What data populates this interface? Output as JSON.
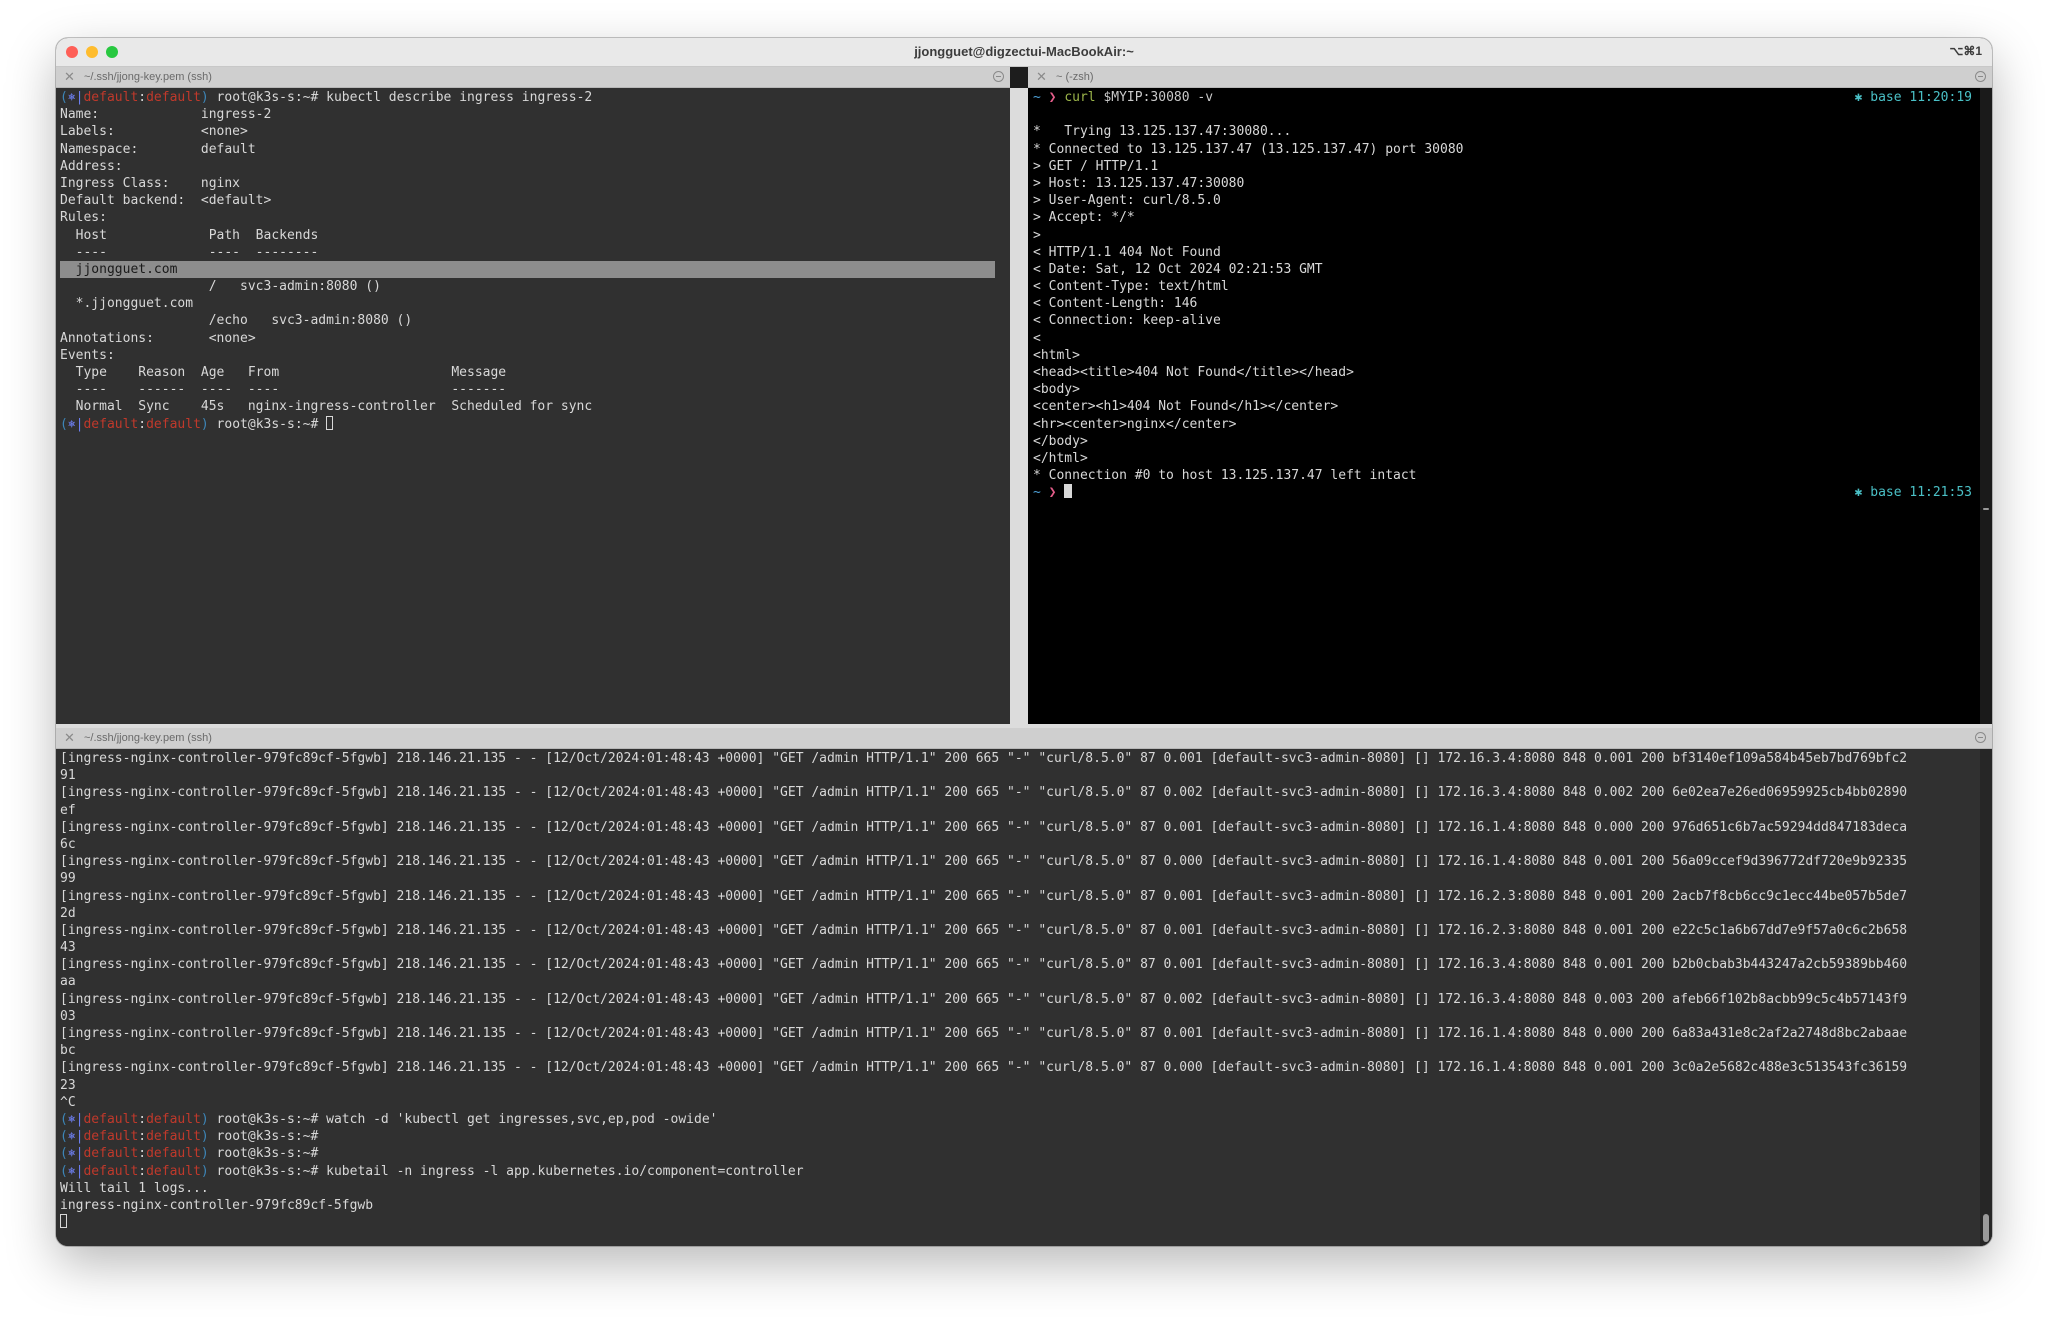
{
  "window": {
    "title": "jjongguet@digzectui-MacBookAir:~",
    "shortcut": "⌥⌘1"
  },
  "panes": [
    {
      "title": "~/.ssh/jjong-key.pem (ssh)",
      "lines": [
        "(⎈|default:default) root@k3s-s:~# kubectl describe ingress ingress-2",
        "Name:             ingress-2",
        "Labels:           <none>",
        "Namespace:        default",
        "Address:",
        "Ingress Class:    nginx",
        "Default backend:  <default>",
        "Rules:",
        "  Host             Path  Backends",
        "  ----             ----  --------",
        "  jjongguet.com",
        "                   /   svc3-admin:8080 ()",
        "  *.jjongguet.com",
        "                   /echo   svc3-admin:8080 ()",
        "Annotations:       <none>",
        "Events:",
        "  Type    Reason  Age   From                      Message",
        "  ----    ------  ----  ----                      -------",
        "  Normal  Sync    45s   nginx-ingress-controller  Scheduled for sync",
        "(⎈|default:default) root@k3s-s:~# "
      ]
    },
    {
      "title": "~ (-zsh)",
      "prompt_cmd": "curl",
      "prompt_args": " $MYIP:30080 -v",
      "rprompt_first": "✱ base 11:20:19",
      "rprompt_last": "✱ base 11:21:53",
      "lines": [
        "",
        "*   Trying 13.125.137.47:30080...",
        "* Connected to 13.125.137.47 (13.125.137.47) port 30080",
        "> GET / HTTP/1.1",
        "> Host: 13.125.137.47:30080",
        "> User-Agent: curl/8.5.0",
        "> Accept: */*",
        ">",
        "< HTTP/1.1 404 Not Found",
        "< Date: Sat, 12 Oct 2024 02:21:53 GMT",
        "< Content-Type: text/html",
        "< Content-Length: 146",
        "< Connection: keep-alive",
        "<",
        "<html>",
        "<head><title>404 Not Found</title></head>",
        "<body>",
        "<center><h1>404 Not Found</h1></center>",
        "<hr><center>nginx</center>",
        "</body>",
        "</html>",
        "* Connection #0 to host 13.125.137.47 left intact"
      ]
    },
    {
      "title": "~/.ssh/jjong-key.pem (ssh)",
      "log_lines": [
        "[ingress-nginx-controller-979fc89cf-5fgwb] 218.146.21.135 - - [12/Oct/2024:01:48:43 +0000] \"GET /admin HTTP/1.1\" 200 665 \"-\" \"curl/8.5.0\" 87 0.001 [default-svc3-admin-8080] [] 172.16.3.4:8080 848 0.001 200 bf3140ef109a584b45eb7bd769bfc2",
        "91",
        "[ingress-nginx-controller-979fc89cf-5fgwb] 218.146.21.135 - - [12/Oct/2024:01:48:43 +0000] \"GET /admin HTTP/1.1\" 200 665 \"-\" \"curl/8.5.0\" 87 0.002 [default-svc3-admin-8080] [] 172.16.3.4:8080 848 0.002 200 6e02ea7e26ed06959925cb4bb02890",
        "ef",
        "[ingress-nginx-controller-979fc89cf-5fgwb] 218.146.21.135 - - [12/Oct/2024:01:48:43 +0000] \"GET /admin HTTP/1.1\" 200 665 \"-\" \"curl/8.5.0\" 87 0.001 [default-svc3-admin-8080] [] 172.16.1.4:8080 848 0.000 200 976d651c6b7ac59294dd847183deca",
        "6c",
        "[ingress-nginx-controller-979fc89cf-5fgwb] 218.146.21.135 - - [12/Oct/2024:01:48:43 +0000] \"GET /admin HTTP/1.1\" 200 665 \"-\" \"curl/8.5.0\" 87 0.000 [default-svc3-admin-8080] [] 172.16.1.4:8080 848 0.001 200 56a09ccef9d396772df720e9b92335",
        "99",
        "[ingress-nginx-controller-979fc89cf-5fgwb] 218.146.21.135 - - [12/Oct/2024:01:48:43 +0000] \"GET /admin HTTP/1.1\" 200 665 \"-\" \"curl/8.5.0\" 87 0.001 [default-svc3-admin-8080] [] 172.16.2.3:8080 848 0.001 200 2acb7f8cb6cc9c1ecc44be057b5de7",
        "2d",
        "[ingress-nginx-controller-979fc89cf-5fgwb] 218.146.21.135 - - [12/Oct/2024:01:48:43 +0000] \"GET /admin HTTP/1.1\" 200 665 \"-\" \"curl/8.5.0\" 87 0.001 [default-svc3-admin-8080] [] 172.16.2.3:8080 848 0.001 200 e22c5c1a6b67dd7e9f57a0c6c2b658",
        "43",
        "[ingress-nginx-controller-979fc89cf-5fgwb] 218.146.21.135 - - [12/Oct/2024:01:48:43 +0000] \"GET /admin HTTP/1.1\" 200 665 \"-\" \"curl/8.5.0\" 87 0.001 [default-svc3-admin-8080] [] 172.16.3.4:8080 848 0.001 200 b2b0cbab3b443247a2cb59389bb460",
        "aa",
        "[ingress-nginx-controller-979fc89cf-5fgwb] 218.146.21.135 - - [12/Oct/2024:01:48:43 +0000] \"GET /admin HTTP/1.1\" 200 665 \"-\" \"curl/8.5.0\" 87 0.002 [default-svc3-admin-8080] [] 172.16.3.4:8080 848 0.003 200 afeb66f102b8acbb99c5c4b57143f9",
        "03",
        "[ingress-nginx-controller-979fc89cf-5fgwb] 218.146.21.135 - - [12/Oct/2024:01:48:43 +0000] \"GET /admin HTTP/1.1\" 200 665 \"-\" \"curl/8.5.0\" 87 0.001 [default-svc3-admin-8080] [] 172.16.1.4:8080 848 0.000 200 6a83a431e8c2af2a2748d8bc2abaae",
        "bc",
        "[ingress-nginx-controller-979fc89cf-5fgwb] 218.146.21.135 - - [12/Oct/2024:01:48:43 +0000] \"GET /admin HTTP/1.1\" 200 665 \"-\" \"curl/8.5.0\" 87 0.000 [default-svc3-admin-8080] [] 172.16.1.4:8080 848 0.001 200 3c0a2e5682c488e3c513543fc36159",
        "23",
        "^C"
      ],
      "prompt_lines": [
        "(⎈|default:default) root@k3s-s:~# watch -d 'kubectl get ingresses,svc,ep,pod -owide'",
        "(⎈|default:default) root@k3s-s:~#",
        "(⎈|default:default) root@k3s-s:~#",
        "(⎈|default:default) root@k3s-s:~# kubetail -n ingress -l app.kubernetes.io/component=controller"
      ],
      "tail_lines": [
        "Will tail 1 logs...",
        "ingress-nginx-controller-979fc89cf-5fgwb"
      ]
    }
  ],
  "colors": {
    "term_bg": "#303030",
    "term_black_bg": "#000000",
    "prompt_context": "#c0392b",
    "prompt_rprompt": "#4ac0c6"
  }
}
